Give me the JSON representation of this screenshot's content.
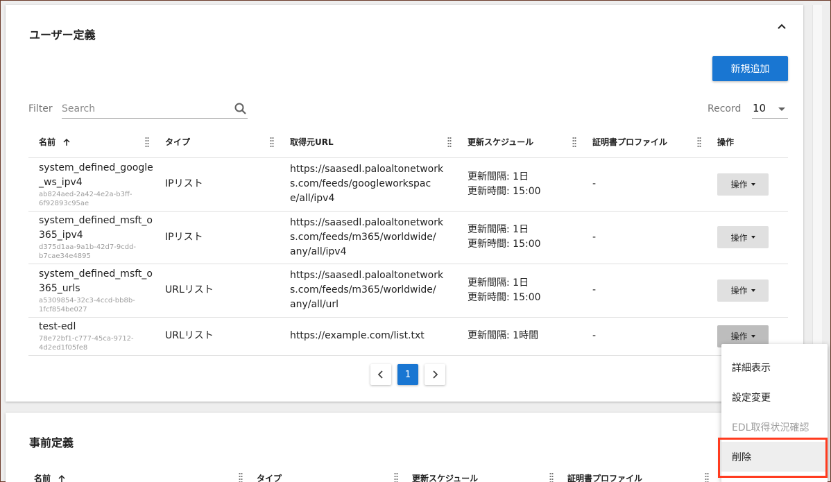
{
  "user_section": {
    "title": "ユーザー定義",
    "add_button": "新規追加",
    "filter_label": "Filter",
    "search_placeholder": "Search",
    "record_label": "Record",
    "record_value": "10",
    "columns": [
      "名前",
      "タイプ",
      "取得元URL",
      "更新スケジュール",
      "証明書プロファイル",
      "操作"
    ],
    "rows": [
      {
        "name_lines": [
          "system_defined_google",
          "_ws_ipv4"
        ],
        "id_lines": [
          "ab824aed-2a42-4e2a-b3ff-",
          "6f92893c95ae"
        ],
        "type": "IPリスト",
        "url_lines": [
          "https://saasedl.paloaltonetwork",
          "s.com/feeds/googleworkspac",
          "e/all/ipv4"
        ],
        "schedule_lines": [
          "更新間隔: 1日",
          "更新時間: 15:00"
        ],
        "cert": "-",
        "ops": "操作"
      },
      {
        "name_lines": [
          "system_defined_msft_o",
          "365_ipv4"
        ],
        "id_lines": [
          "d375d1aa-9a1b-42d7-9cdd-",
          "b7cae34e4895"
        ],
        "type": "IPリスト",
        "url_lines": [
          "https://saasedl.paloaltonetwork",
          "s.com/feeds/m365/worldwide/",
          "any/all/ipv4"
        ],
        "schedule_lines": [
          "更新間隔: 1日",
          "更新時間: 15:00"
        ],
        "cert": "-",
        "ops": "操作"
      },
      {
        "name_lines": [
          "system_defined_msft_o",
          "365_urls"
        ],
        "id_lines": [
          "a5309854-32c3-4ccd-bb8b-",
          "1fcf854be027"
        ],
        "type": "URLリスト",
        "url_lines": [
          "https://saasedl.paloaltonetwork",
          "s.com/feeds/m365/worldwide/",
          "any/all/url"
        ],
        "schedule_lines": [
          "更新間隔: 1日",
          "更新時間: 15:00"
        ],
        "cert": "-",
        "ops": "操作"
      },
      {
        "name_lines": [
          "test-edl"
        ],
        "id_lines": [
          "78e72bf1-c777-45ca-9712-",
          "4d2ed1f05fe8"
        ],
        "type": "URLリスト",
        "url_lines": [
          "https://example.com/list.txt"
        ],
        "schedule_lines": [
          "更新間隔: 1時間"
        ],
        "cert": "-",
        "ops": "操作"
      }
    ],
    "pagination": {
      "current": "1"
    }
  },
  "dropdown_menu": {
    "items": [
      "詳細表示",
      "設定変更",
      "EDL取得状況確認",
      "削除"
    ]
  },
  "predefined_section": {
    "title": "事前定義",
    "columns": [
      "名前",
      "タイプ",
      "更新スケジュール",
      "証明書プロファイル"
    ]
  },
  "colors": {
    "primary": "#1976d2",
    "highlight": "#ff3b1f"
  }
}
